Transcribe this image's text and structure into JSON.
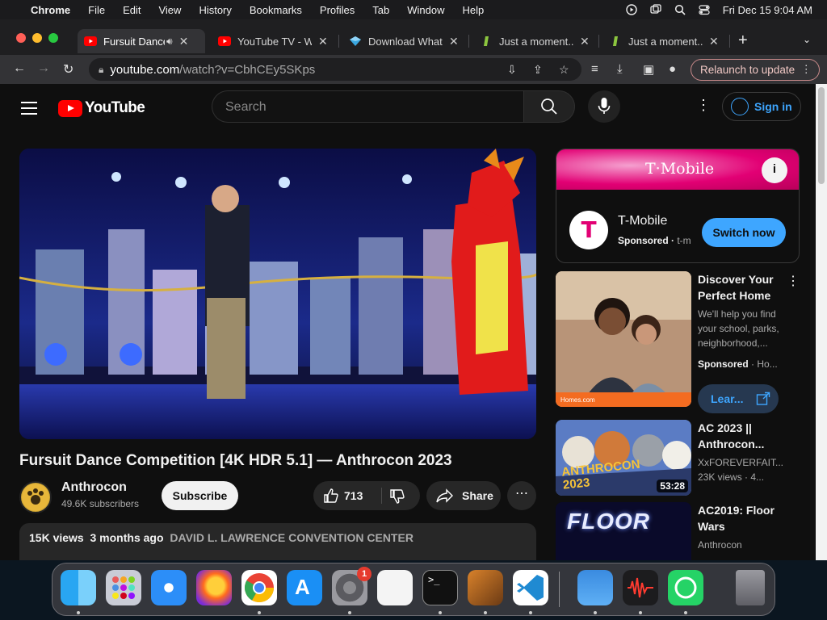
{
  "menubar": {
    "app": "Chrome",
    "items": [
      "File",
      "Edit",
      "View",
      "History",
      "Bookmarks",
      "Profiles",
      "Tab",
      "Window",
      "Help"
    ],
    "clock": "Fri Dec 15  9:04 AM"
  },
  "tabs": [
    {
      "title": "Fursuit Dance",
      "active": true
    },
    {
      "title": "YouTube TV - Wa"
    },
    {
      "title": "Download Whats"
    },
    {
      "title": "Just a moment..."
    },
    {
      "title": "Just a moment..."
    }
  ],
  "omnibox": {
    "host": "youtube.com",
    "path": "/watch?v=CbhCEy5SKps"
  },
  "relaunch_label": "Relaunch to update",
  "youtube": {
    "logo_text": "YouTube",
    "search_placeholder": "Search",
    "sign_in": "Sign in",
    "video": {
      "title": "Fursuit Dance Competition [4K HDR 5.1] — Anthrocon 2023",
      "channel": "Anthrocon",
      "subscribers": "49.6K subscribers",
      "subscribe": "Subscribe",
      "likes": "713",
      "share": "Share",
      "views": "15K views",
      "age": "3 months ago",
      "location": "DAVID L. LAWRENCE CONVENTION CENTER"
    },
    "ad": {
      "brand_banner": "T·Mobile",
      "advertiser": "T-Mobile",
      "sponsored": "Sponsored",
      "domain": "t-m",
      "cta": "Switch now"
    },
    "recommendations": [
      {
        "title": "Discover Your Perfect Home",
        "meta1": "We'll help you find your school, parks, neighborhood,...",
        "meta2": "Sponsored",
        "meta2b": "Ho...",
        "cta": "Lear...",
        "thumb_caption": "Homes.com"
      },
      {
        "title": "AC 2023 || Anthrocon...",
        "meta1": "XxFOREVERFAIT...",
        "meta2": "23K views · 4...",
        "duration": "53:28",
        "thumb_text": "ANTHROCON 2023"
      },
      {
        "title": "AC2019: Floor Wars",
        "meta1": "Anthrocon",
        "thumb_text": "FLOOR"
      }
    ]
  },
  "dock": {
    "badge": "1"
  },
  "colors": {
    "accent_blue": "#3ea6ff",
    "yt_red": "#ff0000",
    "tmobile_magenta": "#e20074"
  }
}
